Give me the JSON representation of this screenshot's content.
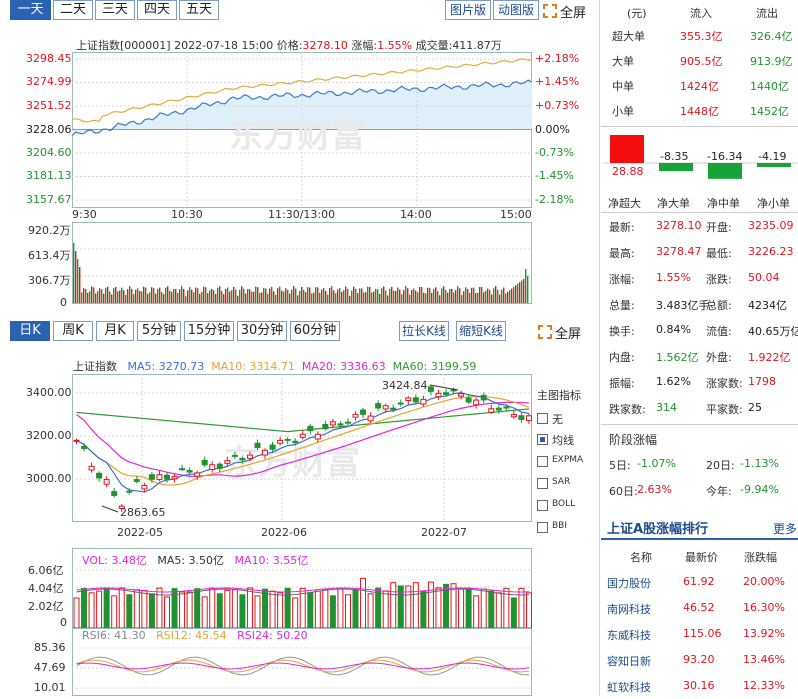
{
  "period_tabs": [
    "一天",
    "二天",
    "三天",
    "四天",
    "五天"
  ],
  "intraday_buttons": {
    "image": "图片版",
    "animated": "动图版",
    "full": "全屏"
  },
  "intraday": {
    "header_index": "上证指数[000001]",
    "header_time": "2022-07-18 15:00",
    "price_label": "价格:",
    "price": "3278.10",
    "change_label": "涨幅:",
    "change_pct": "1.55%",
    "volume_label": "成交量:",
    "volume": "411.87万",
    "left_ticks": [
      "3298.45",
      "3274.99",
      "3251.52",
      "3228.06",
      "3204.60",
      "3181.13",
      "3157.67"
    ],
    "right_ticks": [
      "+2.18%",
      "+1.45%",
      "+0.73%",
      "0.00%",
      "-0.73%",
      "-1.45%",
      "-2.18%"
    ],
    "x_ticks": [
      "9:30",
      "10:30",
      "11:30/13:00",
      "14:00",
      "15:00"
    ],
    "vol_ticks": [
      "920.2万",
      "613.4万",
      "306.7万",
      "0"
    ],
    "watermark": "东方财富"
  },
  "kline_tabs": [
    "日K",
    "周K",
    "月K",
    "5分钟",
    "15分钟",
    "30分钟",
    "60分钟"
  ],
  "kline_buttons": {
    "stretch": "拉长K线",
    "shrink": "缩短K线",
    "full": "全屏"
  },
  "kline": {
    "name": "上证指数",
    "ma5_label": "MA5: 3270.73",
    "ma10_label": "MA10: 3314.71",
    "ma20_label": "MA20: 3336.63",
    "ma60_label": "MA60: 3199.59",
    "ma_colors": {
      "ma5": "#3a6fd6",
      "ma10": "#e6a533",
      "ma20": "#e028d8",
      "ma60": "#2f9a2f"
    },
    "y_ticks": [
      "3400.00",
      "3200.00",
      "3000.00"
    ],
    "x_ticks": [
      "2022-05",
      "2022-06",
      "2022-07"
    ],
    "high_annot": "3424.84",
    "low_annot": "2863.65",
    "indicator_title": "主图指标",
    "indicators": [
      {
        "label": "无",
        "checked": false
      },
      {
        "label": "均线",
        "checked": true
      },
      {
        "label": "EXPMA",
        "checked": false
      },
      {
        "label": "SAR",
        "checked": false
      },
      {
        "label": "BOLL",
        "checked": false
      },
      {
        "label": "BBI",
        "checked": false
      }
    ]
  },
  "vol_panel": {
    "vol_label": "VOL: 3.48亿",
    "ma5_label": "MA5: 3.50亿",
    "ma10_label": "MA10: 3.55亿",
    "ticks": [
      "6.06亿",
      "4.04亿",
      "2.02亿",
      "0"
    ]
  },
  "rsi_panel": {
    "rsi6": "RSI6: 41.30",
    "rsi12": "RSI12: 45.54",
    "rsi24": "RSI24: 50.20",
    "ticks": [
      "85.36",
      "47.69",
      "10.01"
    ]
  },
  "flow": {
    "headers": [
      "(元)",
      "流入",
      "流出"
    ],
    "rows": [
      {
        "name": "超大单",
        "in": "355.3亿",
        "out": "326.4亿"
      },
      {
        "name": "大单",
        "in": "905.5亿",
        "out": "913.9亿"
      },
      {
        "name": "中单",
        "in": "1424亿",
        "out": "1440亿"
      },
      {
        "name": "小单",
        "in": "1448亿",
        "out": "1452亿"
      }
    ],
    "net_values": [
      "28.88",
      "-8.35",
      "-16.34",
      "-4.19"
    ],
    "net_labels": [
      "净超大",
      "净大单",
      "净中单",
      "净小单"
    ]
  },
  "stats": [
    {
      "l1": "最新:",
      "v1": "3278.10",
      "c1": "red",
      "l2": "开盘:",
      "v2": "3235.09",
      "c2": "red"
    },
    {
      "l1": "最高:",
      "v1": "3278.47",
      "c1": "red",
      "l2": "最低:",
      "v2": "3226.23",
      "c2": "red"
    },
    {
      "l1": "涨幅:",
      "v1": "1.55%",
      "c1": "red",
      "l2": "涨跌:",
      "v2": "50.04",
      "c2": "red"
    },
    {
      "l1": "总量:",
      "v1": "3.483亿手",
      "c1": "blk",
      "l2": "总额:",
      "v2": "4234亿",
      "c2": "blk"
    },
    {
      "l1": "换手:",
      "v1": "0.84%",
      "c1": "blk",
      "l2": "流值:",
      "v2": "40.65万亿",
      "c2": "blk"
    },
    {
      "l1": "内盘:",
      "v1": "1.562亿",
      "c1": "grn",
      "l2": "外盘:",
      "v2": "1.922亿",
      "c2": "red"
    },
    {
      "l1": "振幅:",
      "v1": "1.62%",
      "c1": "blk",
      "l2": "涨家数:",
      "v2": "1798",
      "c2": "red"
    },
    {
      "l1": "跌家数:",
      "v1": "314",
      "c1": "grn",
      "l2": "平家数:",
      "v2": "25",
      "c2": "blk"
    }
  ],
  "stage": {
    "title": "阶段涨幅",
    "items": [
      {
        "l": "5日:",
        "v": "-1.07%",
        "c": "grn"
      },
      {
        "l": "20日:",
        "v": "-1.13%",
        "c": "grn"
      },
      {
        "l": "60日:",
        "v": "2.63%",
        "c": "red"
      },
      {
        "l": "今年:",
        "v": "-9.94%",
        "c": "grn"
      }
    ]
  },
  "ranking": {
    "title": "上证A股涨幅排行",
    "more": "更多",
    "headers": [
      "名称",
      "最新价",
      "涨跌幅"
    ],
    "rows": [
      {
        "name": "国力股份",
        "price": "61.92",
        "pct": "20.00%"
      },
      {
        "name": "南网科技",
        "price": "46.52",
        "pct": "16.30%"
      },
      {
        "name": "东威科技",
        "price": "115.06",
        "pct": "13.92%"
      },
      {
        "name": "容知日新",
        "price": "93.20",
        "pct": "13.46%"
      },
      {
        "name": "虹软科技",
        "price": "30.16",
        "pct": "12.33%"
      }
    ]
  }
}
